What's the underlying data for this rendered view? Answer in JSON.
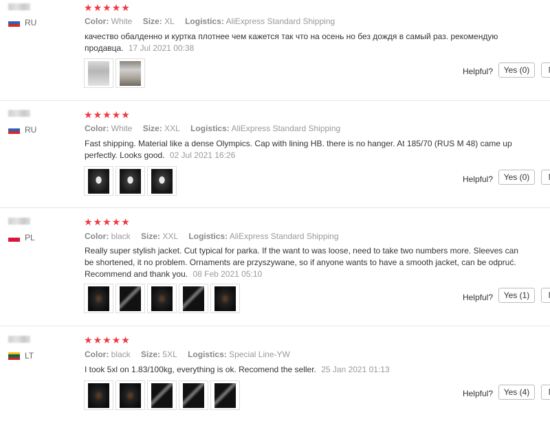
{
  "labels": {
    "color": "Color:",
    "size": "Size:",
    "logistics": "Logistics:",
    "helpful": "Helpful?"
  },
  "colors": {
    "star": "#f0393f",
    "muted": "#999999",
    "text": "#333333"
  },
  "reviews": [
    {
      "country": "RU",
      "stars": 5,
      "color": "White",
      "size": "XL",
      "logistics": "AliExpress Standard Shipping",
      "text": "качество обалденно и куртка плотнее чем кажется так что на осень но без дождя в самый раз. рекомендую продавца.",
      "date": "17 Jul 2021 00:38",
      "yes": "Yes (0)",
      "no": "N",
      "photos": 2
    },
    {
      "country": "RU",
      "stars": 5,
      "color": "White",
      "size": "XXL",
      "logistics": "AliExpress Standard Shipping",
      "text": "Fast shipping. Material like a dense Olympics. Cap with lining HB. there is no hanger. At 185/70 (RUS M 48) came up perfectly. Looks good.",
      "date": "02 Jul 2021 16:26",
      "yes": "Yes (0)",
      "no": "N",
      "photos": 3
    },
    {
      "country": "PL",
      "stars": 5,
      "color": "black",
      "size": "XXL",
      "logistics": "AliExpress Standard Shipping",
      "text": "Really super stylish jacket. Cut typical for parka. If the want to was loose, need to take two numbers more. Sleeves can be shortened, it no problem. Ornaments are przyszywane, so if anyone wants to have a smooth jacket, can be odpruć. Recommend and thank you.",
      "date": "08 Feb 2021 05:10",
      "yes": "Yes (1)",
      "no": "N",
      "photos": 5
    },
    {
      "country": "LT",
      "stars": 5,
      "color": "black",
      "size": "5XL",
      "logistics": "Special Line-YW",
      "text": "I took 5xl on 1.83/100kg, everything is ok. Recomend the seller.",
      "date": "25 Jan 2021 01:13",
      "yes": "Yes (4)",
      "no": "N",
      "photos": 5
    }
  ]
}
